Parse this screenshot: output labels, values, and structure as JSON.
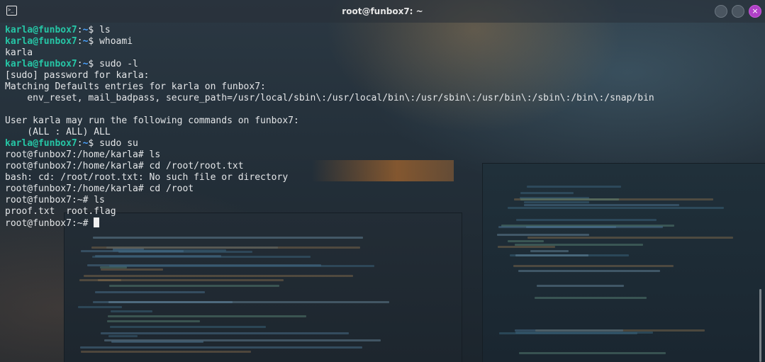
{
  "window": {
    "title": "root@funbox7: ~",
    "icon": "terminal-icon",
    "close_glyph": "×"
  },
  "terminal": {
    "lines": [
      {
        "user": "karla@funbox7",
        "colon": ":",
        "path": "~",
        "sym": "$ ",
        "text": "ls"
      },
      {
        "user": "karla@funbox7",
        "colon": ":",
        "path": "~",
        "sym": "$ ",
        "text": "whoami"
      },
      {
        "text": "karla"
      },
      {
        "user": "karla@funbox7",
        "colon": ":",
        "path": "~",
        "sym": "$ ",
        "text": "sudo -l"
      },
      {
        "text": "[sudo] password for karla:"
      },
      {
        "text": "Matching Defaults entries for karla on funbox7:"
      },
      {
        "text": "    env_reset, mail_badpass, secure_path=/usr/local/sbin\\:/usr/local/bin\\:/usr/sbin\\:/usr/bin\\:/sbin\\:/bin\\:/snap/bin"
      },
      {
        "text": ""
      },
      {
        "text": "User karla may run the following commands on funbox7:"
      },
      {
        "text": "    (ALL : ALL) ALL"
      },
      {
        "user": "karla@funbox7",
        "colon": ":",
        "path": "~",
        "sym": "$ ",
        "text": "sudo su"
      },
      {
        "text": "root@funbox7:/home/karla# ls"
      },
      {
        "text": "root@funbox7:/home/karla# cd /root/root.txt"
      },
      {
        "text": "bash: cd: /root/root.txt: No such file or directory"
      },
      {
        "text": "root@funbox7:/home/karla# cd /root"
      },
      {
        "text": "root@funbox7:~# ls"
      },
      {
        "text": "proof.txt  root.flag"
      },
      {
        "text": "root@funbox7:~# ",
        "cursor": true
      }
    ]
  },
  "colors": {
    "user_prompt": "#26c6a6",
    "path_prompt": "#4aa3ff",
    "text": "#e4e6e8",
    "close_button": "#b040c8"
  }
}
